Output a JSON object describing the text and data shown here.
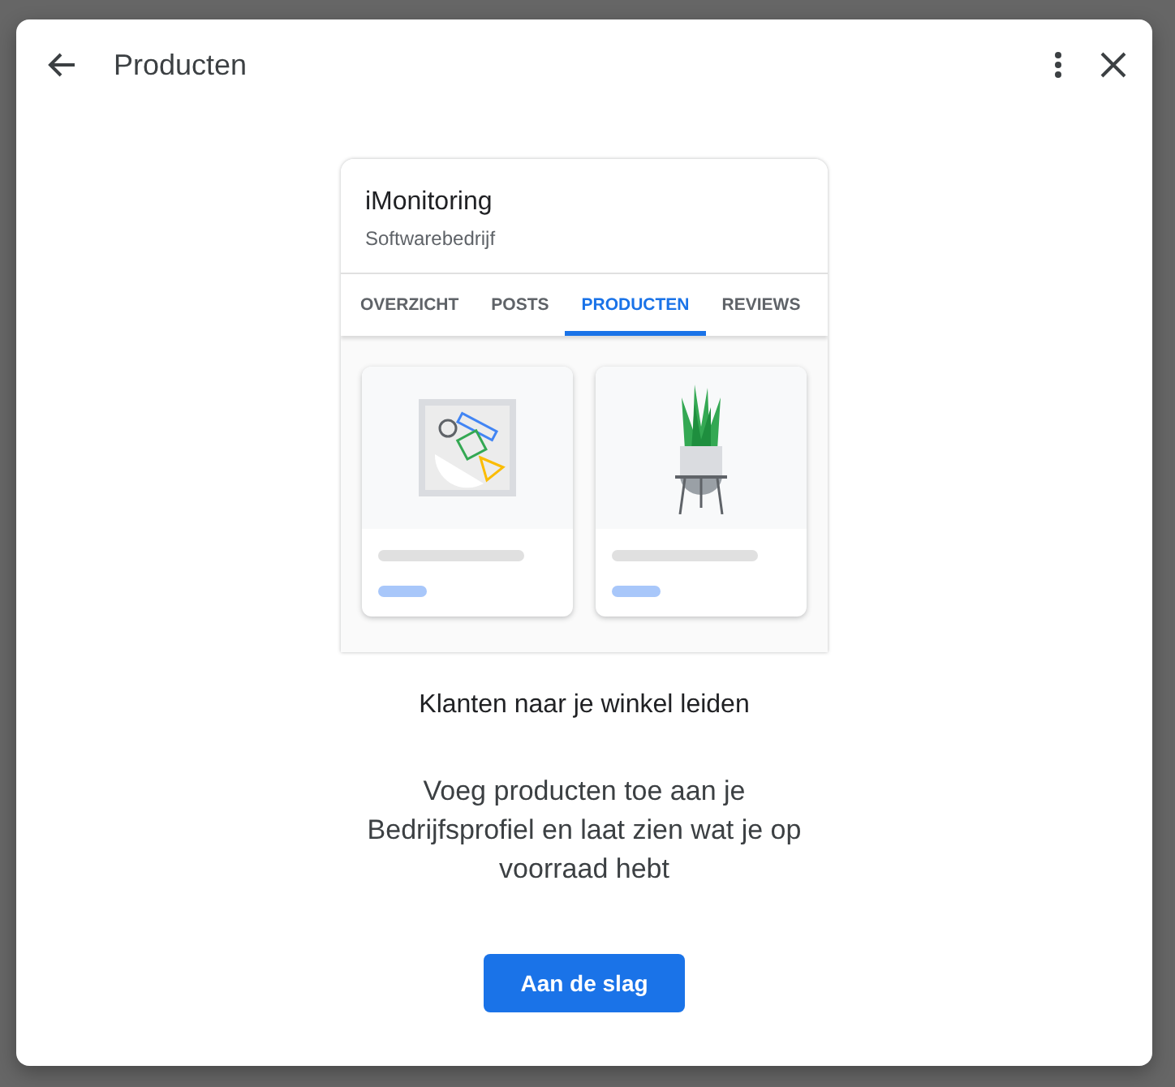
{
  "dialog": {
    "title": "Producten"
  },
  "preview": {
    "business_name": "iMonitoring",
    "category": "Softwarebedrijf",
    "tabs": [
      {
        "label": "OVERZICHT",
        "selected": false
      },
      {
        "label": "POSTS",
        "selected": false
      },
      {
        "label": "PRODUCTEN",
        "selected": true
      },
      {
        "label": "REVIEWS",
        "selected": false
      }
    ],
    "products": [
      {
        "kind": "shapes"
      },
      {
        "kind": "plant"
      }
    ]
  },
  "headline": "Klanten naar je winkel leiden",
  "description": "Voeg producten toe aan je Bedrijfsprofiel en laat zien wat je op voorraad hebt",
  "button": "Aan de slag"
}
